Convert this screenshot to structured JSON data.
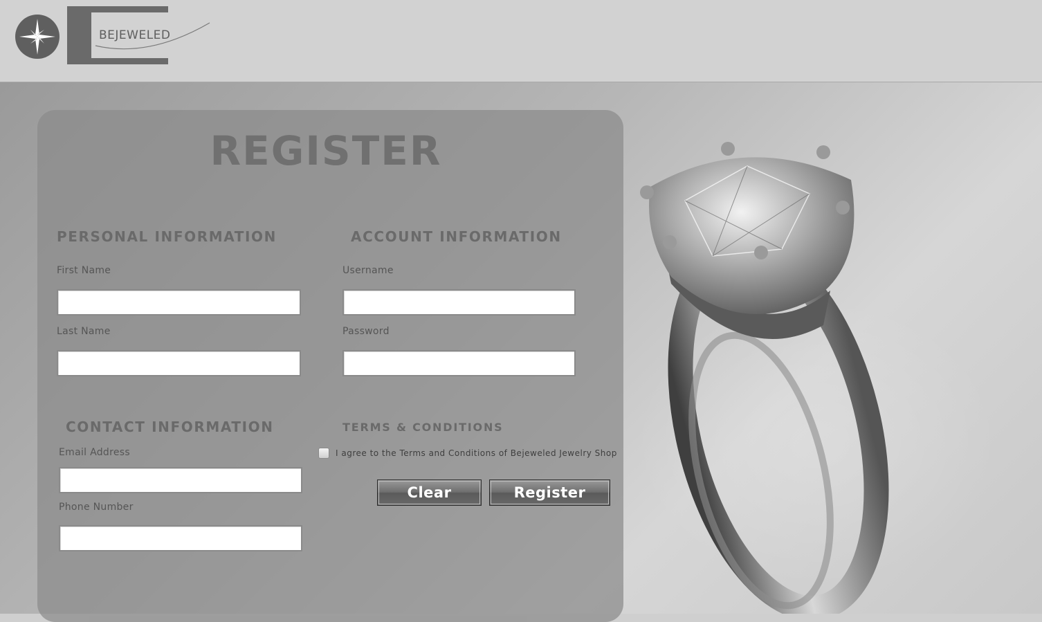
{
  "brand": {
    "name": "BEJEWELED",
    "compass_icon": "compass-star-icon"
  },
  "form": {
    "title": "REGISTER",
    "personal": {
      "heading": "PERSONAL INFORMATION",
      "first_name_label": "First Name",
      "first_name_value": "",
      "last_name_label": "Last Name",
      "last_name_value": ""
    },
    "account": {
      "heading": "ACCOUNT INFORMATION",
      "username_label": "Username",
      "username_value": "",
      "password_label": "Password",
      "password_value": ""
    },
    "contact": {
      "heading": "CONTACT INFORMATION",
      "email_label": "Email Address",
      "email_value": "",
      "phone_label": "Phone Number",
      "phone_value": ""
    },
    "terms": {
      "heading": "TERMS & CONDITIONS",
      "agree_text": "I agree to the Terms and Conditions of Bejeweled Jewelry Shop",
      "checked": false
    },
    "buttons": {
      "clear": "Clear",
      "register": "Register"
    }
  },
  "colors": {
    "header_bg": "#d2d2d2",
    "panel_bg": "#8a8a8a",
    "heading": "#6a6a6a",
    "button": "#6e6e6e"
  }
}
